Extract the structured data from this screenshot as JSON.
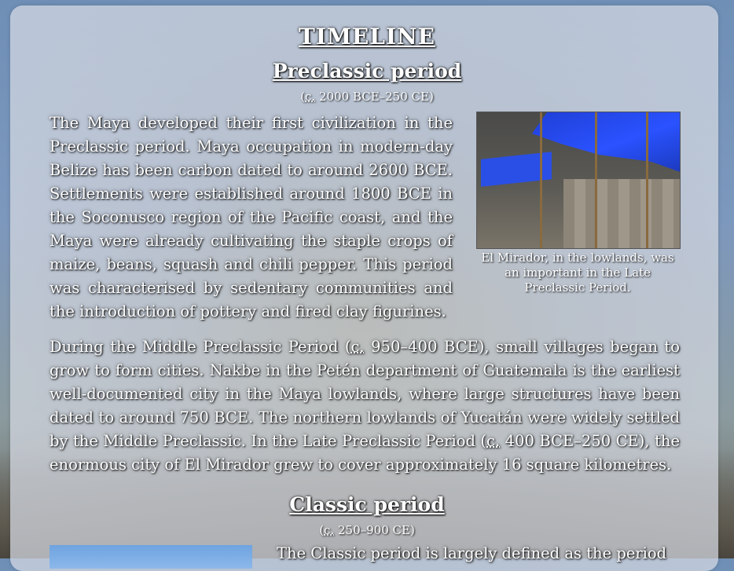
{
  "timeline": {
    "title": "TIMELINE",
    "preclassic": {
      "title": "Preclassic period",
      "dates_open": "(",
      "dates_abbr": "c.",
      "dates_rest": " 2000 BCE–250 CE)",
      "paragraph1": "The Maya developed their first civilization in the Preclassic period. Maya occupation in modern-day Belize has been carbon dated to around 2600 BCE. Settlements were established around 1800 BCE in the Soconusco region of the Pacific coast, and the Maya were already cultivating the staple crops of maize, beans, squash and chili pepper. This period was characterised by sedentary communities and the introduction of pottery and fired clay figurines.",
      "paragraph2_a": "During the Middle Preclassic Period (",
      "paragraph2_abbr1": "c.",
      "paragraph2_b": " 950–400 BCE), small villages began to grow to form cities. Nakbe in the Petén department of Guatemala is the earliest well-documented city in the Maya lowlands, where large structures have been dated to around 750 BCE. The northern lowlands of Yucatán were widely settled by the Middle Preclassic. In the Late Preclassic Period (",
      "paragraph2_abbr2": "c.",
      "paragraph2_c": " 400 BCE–250 CE), the enormous city of El Mirador grew to cover approximately 16 square kilometres.",
      "figure_caption": "El Mirador, in the lowlands, was an important in the Late Preclassic Period."
    },
    "classic": {
      "title": "Classic period",
      "dates_open": "(",
      "dates_abbr": "c.",
      "dates_rest": " 250–900 CE)",
      "paragraph1": "The Classic period is largely defined as the period"
    }
  }
}
